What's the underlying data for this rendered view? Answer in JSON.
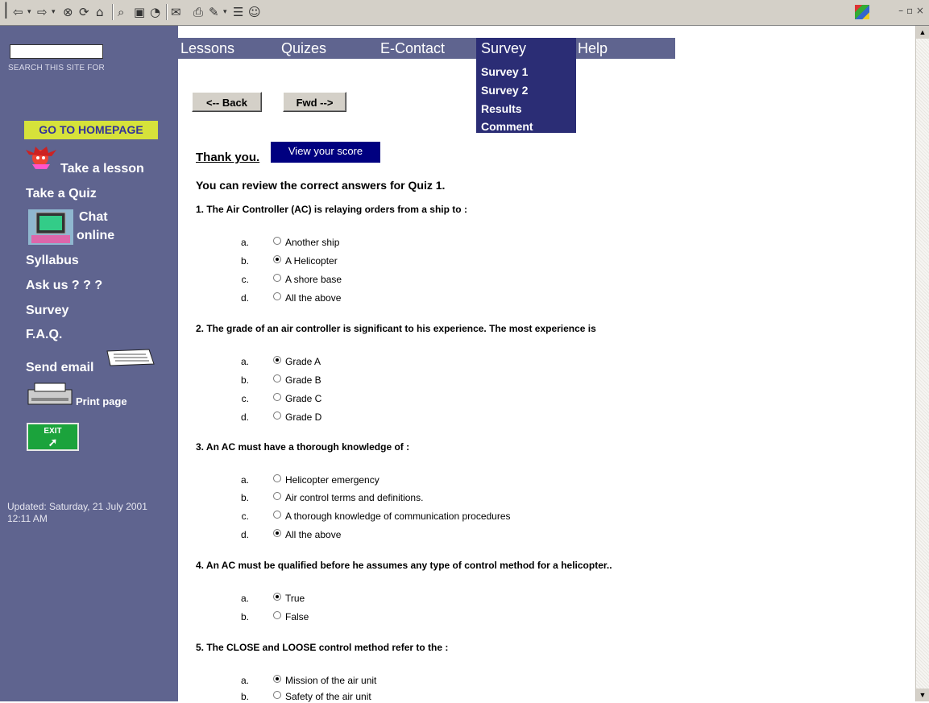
{
  "toolbar": {
    "icons": [
      "back-arrow-icon",
      "dropdown-icon",
      "forward-arrow-icon",
      "dropdown-icon",
      "stop-icon",
      "refresh-icon",
      "home-icon",
      "search-icon",
      "favorites-icon",
      "history-icon",
      "mail-icon",
      "print-icon",
      "edit-icon",
      "discuss-icon",
      "messenger-icon"
    ],
    "window_controls": "– ▫ ×"
  },
  "sidebar": {
    "search_label": "SEARCH THIS SITE FOR",
    "homepage_label": "GO TO HOMEPAGE",
    "take_lesson": "Take a lesson",
    "take_quiz": "Take a Quiz",
    "chat": "Chat",
    "online": "online",
    "syllabus": "Syllabus",
    "ask_us": "Ask us ? ? ?",
    "survey": "Survey",
    "faq": "F.A.Q.",
    "send_email": "Send email",
    "print_page": "Print page",
    "exit_label": "EXIT",
    "updated": "Updated: Saturday, 21 July 2001 12:11 AM"
  },
  "nav": {
    "lessons": "Lessons",
    "quizes": "Quizes",
    "econtact": "E-Contact",
    "survey": "Survey",
    "help": "Help",
    "survey_items": [
      "Survey 1",
      "Survey 2",
      "Results",
      "Comment"
    ]
  },
  "buttons": {
    "back": "<-- Back",
    "fwd": "Fwd -->"
  },
  "content": {
    "thank_you": "Thank you.",
    "view_score": "View your score",
    "review": "You can review the correct answers for Quiz 1."
  },
  "questions": [
    {
      "text": "1. The Air Controller (AC) is relaying orders from a ship to :",
      "options": [
        {
          "letter": "a.",
          "text": "Another ship",
          "checked": false
        },
        {
          "letter": "b.",
          "text": "A Helicopter",
          "checked": true
        },
        {
          "letter": "c.",
          "text": "A shore base",
          "checked": false
        },
        {
          "letter": "d.",
          "text": "All the above",
          "checked": false
        }
      ]
    },
    {
      "text": "2. The grade of an air controller is significant to his experience. The most  experience is",
      "options": [
        {
          "letter": "a.",
          "text": "Grade A",
          "checked": true
        },
        {
          "letter": "b.",
          "text": "Grade B",
          "checked": false
        },
        {
          "letter": "c.",
          "text": "Grade C",
          "checked": false
        },
        {
          "letter": "d.",
          "text": "Grade D",
          "checked": false
        }
      ]
    },
    {
      "text": "3. An AC must have a thorough knowledge of :",
      "options": [
        {
          "letter": "a.",
          "text": "Helicopter emergency",
          "checked": false
        },
        {
          "letter": "b.",
          "text": "Air control terms and definitions.",
          "checked": false
        },
        {
          "letter": "c.",
          "text": "A thorough knowledge of communication procedures",
          "checked": false
        },
        {
          "letter": "d.",
          "text": "All the above",
          "checked": true
        }
      ]
    },
    {
      "text": "4. An AC must be qualified before he assumes any type of control method for a helicopter..",
      "options": [
        {
          "letter": "a.",
          "text": "True",
          "checked": true
        },
        {
          "letter": "b.",
          "text": "False",
          "checked": false
        }
      ]
    },
    {
      "text": "5. The CLOSE and LOOSE control method refer to the :",
      "options": [
        {
          "letter": "a.",
          "text": "Mission of the air unit",
          "checked": true
        },
        {
          "letter": "b.",
          "text": "Safety of the air unit",
          "checked": false
        }
      ]
    }
  ]
}
